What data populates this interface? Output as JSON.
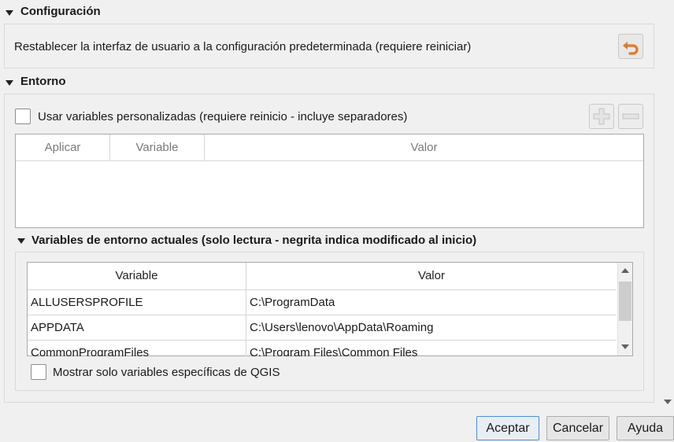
{
  "sections": {
    "configuracion": {
      "title": "Configuración",
      "reset_text": "Restablecer la interfaz de usuario a la configuración predeterminada (requiere reiniciar)",
      "reset_icon": "undo-arrow-icon"
    },
    "entorno": {
      "title": "Entorno",
      "custom_vars_label": "Usar variables personalizadas (requiere reinicio - incluye separadores)",
      "custom_vars_checked": false,
      "custom_table_headers": [
        "Aplicar",
        "Variable",
        "Valor"
      ],
      "add_icon": "plus-icon",
      "remove_icon": "minus-icon"
    },
    "current_vars": {
      "title": "Variables de entorno actuales (solo lectura - negrita indica modificado al inicio)",
      "headers": [
        "Variable",
        "Valor"
      ],
      "rows": [
        {
          "variable": "ALLUSERSPROFILE",
          "valor": "C:\\ProgramData"
        },
        {
          "variable": "APPDATA",
          "valor": "C:\\Users\\lenovo\\AppData\\Roaming"
        },
        {
          "variable": "CommonProgramFiles",
          "valor": "C:\\Program Files\\Common Files"
        }
      ],
      "qgis_only_label": "Mostrar solo variables específicas de QGIS",
      "qgis_only_checked": false
    }
  },
  "footer": {
    "accept": "Aceptar",
    "cancel": "Cancelar",
    "help": "Ayuda"
  },
  "colors": {
    "accent_border": "#4a8fd4",
    "undo_icon": "#e07a2a"
  }
}
